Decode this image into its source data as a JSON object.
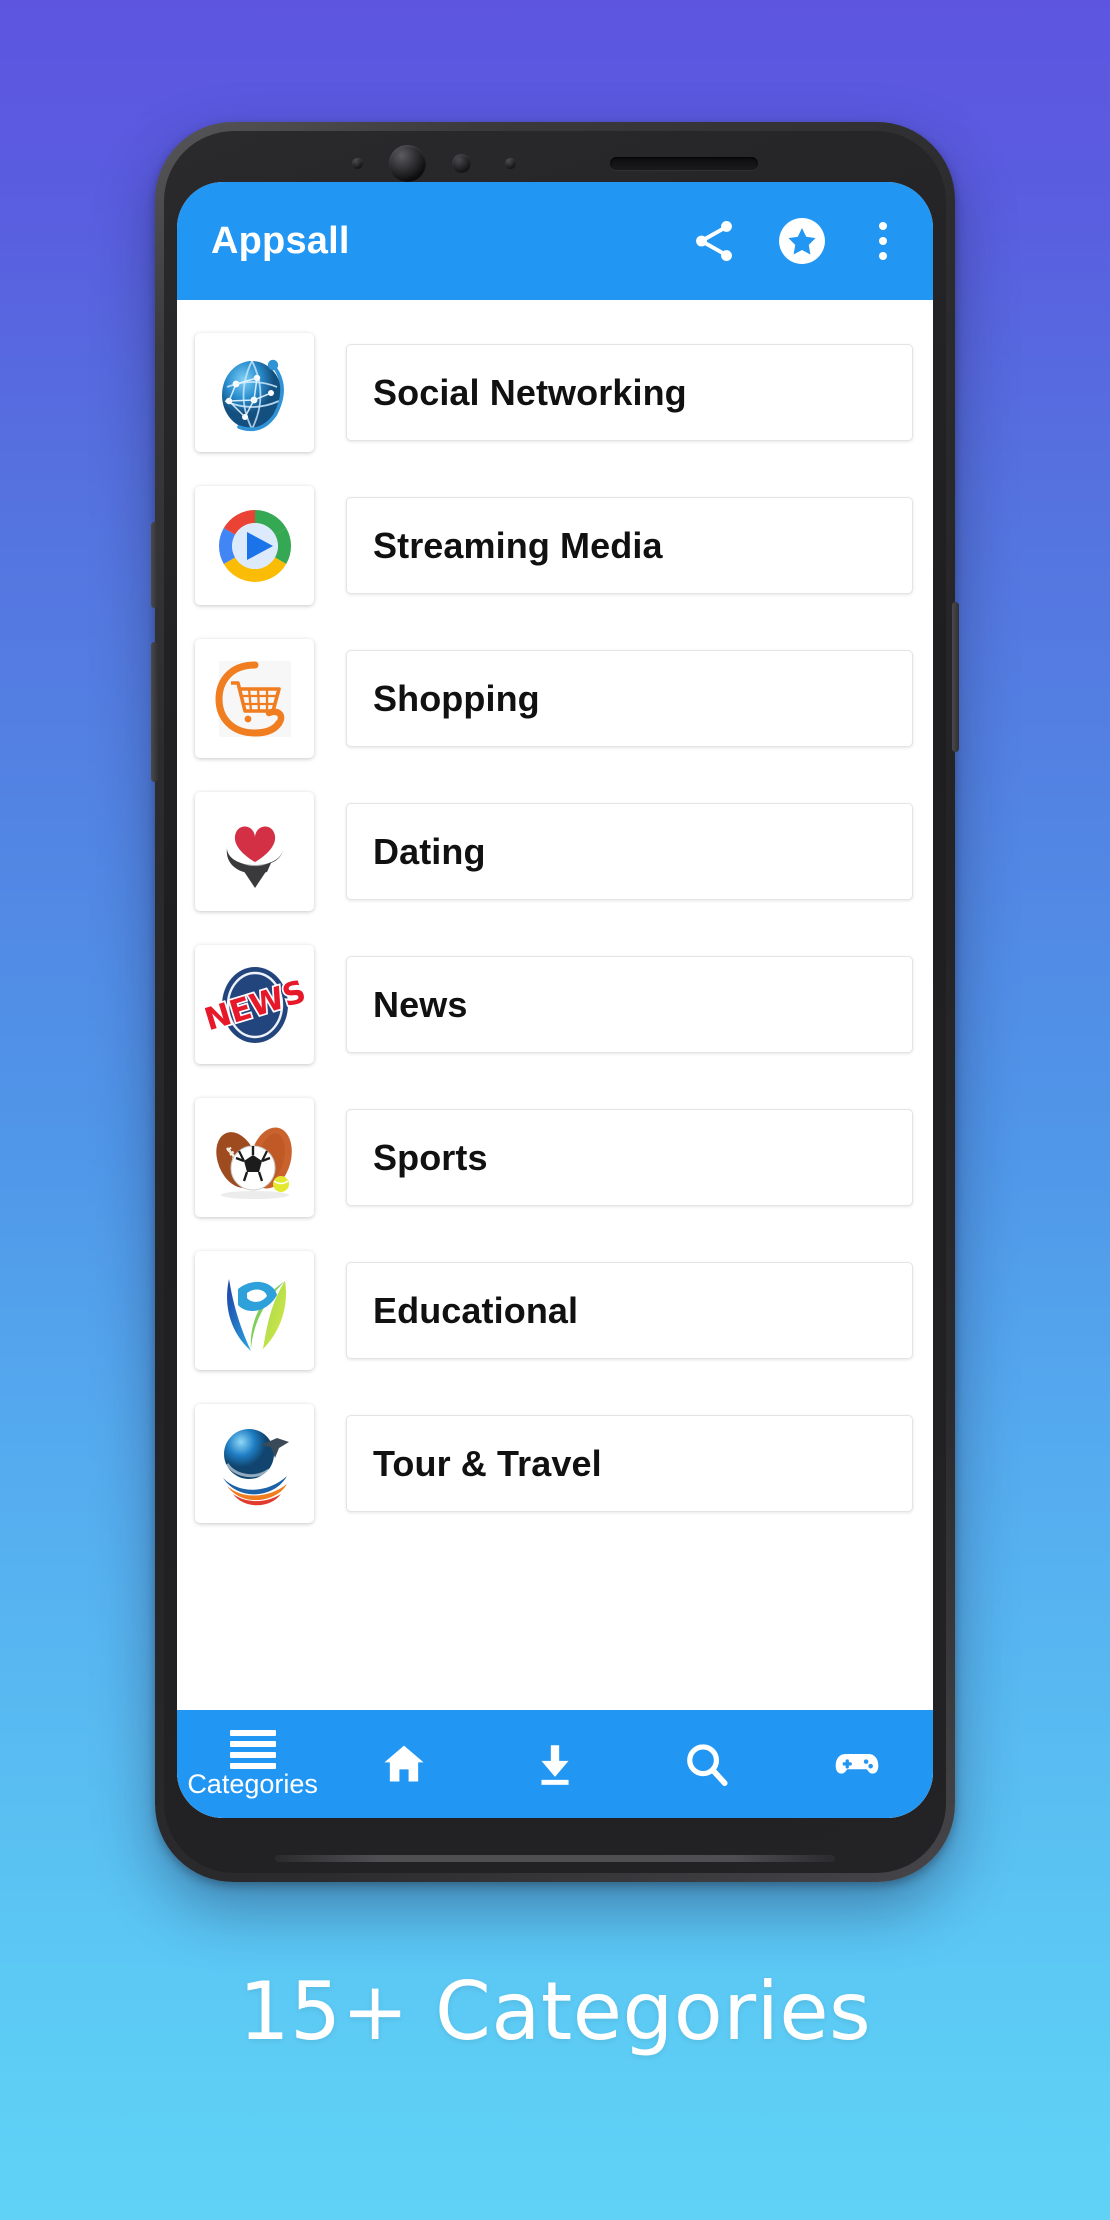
{
  "background": {
    "gradient_from": "#5d55e0",
    "gradient_to": "#60d2f6"
  },
  "phone": {
    "frame_color": "#2c2c2e",
    "sensor_names": [
      "proximity-sensor",
      "front-camera",
      "ambient-sensor",
      "led-indicator",
      "earpiece-speaker"
    ]
  },
  "app": {
    "accent_color": "#2196f3",
    "appbar": {
      "title": "Appsall",
      "actions": [
        {
          "name": "share-icon",
          "label": "Share"
        },
        {
          "name": "star-rate-icon",
          "label": "Rate"
        },
        {
          "name": "overflow-menu-icon",
          "label": "More options"
        }
      ]
    },
    "categories": [
      {
        "label": "Social Networking",
        "icon": "globe-network-icon"
      },
      {
        "label": "Streaming Media",
        "icon": "play-circle-color-icon"
      },
      {
        "label": "Shopping",
        "icon": "shopping-cart-icon"
      },
      {
        "label": "Dating",
        "icon": "heart-pin-icon"
      },
      {
        "label": "News",
        "icon": "news-badge-icon"
      },
      {
        "label": "Sports",
        "icon": "sports-balls-icon"
      },
      {
        "label": "Educational",
        "icon": "graduate-leaf-icon"
      },
      {
        "label": "Tour & Travel",
        "icon": "globe-plane-icon"
      }
    ],
    "bottom_nav": [
      {
        "name": "nav-categories",
        "icon": "hamburger-icon",
        "label": "Categories",
        "active": true
      },
      {
        "name": "nav-home",
        "icon": "home-icon",
        "label": ""
      },
      {
        "name": "nav-downloads",
        "icon": "download-icon",
        "label": ""
      },
      {
        "name": "nav-search",
        "icon": "search-icon",
        "label": ""
      },
      {
        "name": "nav-games",
        "icon": "gamepad-icon",
        "label": ""
      }
    ]
  },
  "promo": {
    "caption": "15+ Categories"
  }
}
